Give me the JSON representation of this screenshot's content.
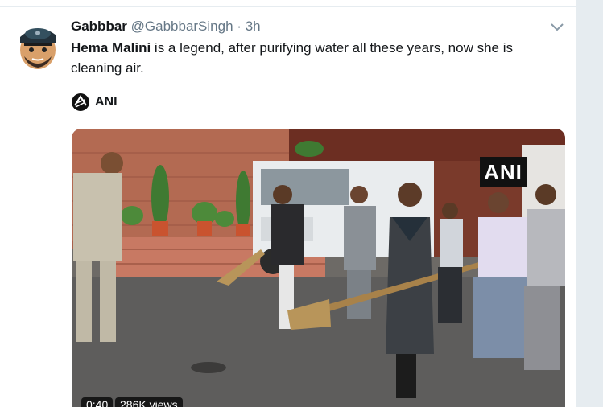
{
  "tweet": {
    "display_name": "Gabbbar",
    "handle": "@GabbbarSingh",
    "separator": "·",
    "time": "3h",
    "text_bold": "Hema Malini",
    "text_rest": " is a legend, after purifying water all these years, now she is cleaning air.",
    "caret_icon": "chevron-down-icon"
  },
  "media": {
    "credit_label": "ANI",
    "watermark": "ANI",
    "duration": "0:40",
    "views": "286K views"
  },
  "colors": {
    "text": "#14171a",
    "secondary": "#657786",
    "background": "#e6ecf0"
  }
}
